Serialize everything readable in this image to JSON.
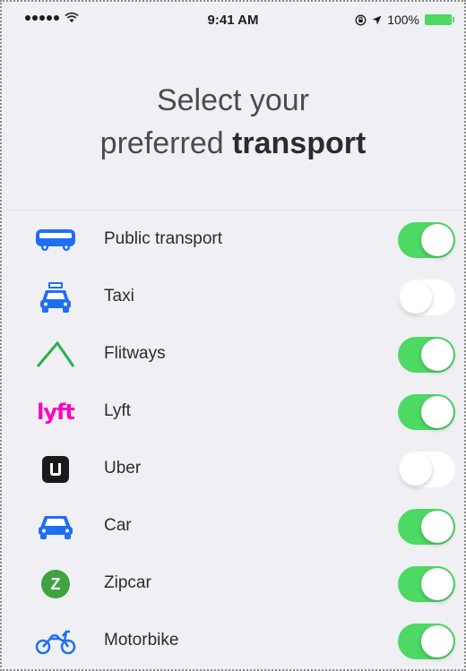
{
  "status_bar": {
    "time": "9:41 AM",
    "battery": "100%"
  },
  "header": {
    "title_line1": "Select your",
    "title_line2_prefix": "preferred ",
    "title_line2_strong": "transport"
  },
  "transport_options": [
    {
      "label": "Public transport",
      "icon": "bus-icon",
      "enabled": true
    },
    {
      "label": "Taxi",
      "icon": "taxi-icon",
      "enabled": false
    },
    {
      "label": "Flitways",
      "icon": "flitways-logo-icon",
      "enabled": true
    },
    {
      "label": "Lyft",
      "icon": "lyft-logo-icon",
      "logo_text": "lyft",
      "enabled": true
    },
    {
      "label": "Uber",
      "icon": "uber-logo-icon",
      "enabled": false
    },
    {
      "label": "Car",
      "icon": "car-icon",
      "enabled": true
    },
    {
      "label": "Zipcar",
      "icon": "zipcar-logo-icon",
      "logo_text": "Z",
      "enabled": true
    },
    {
      "label": "Motorbike",
      "icon": "motorbike-icon",
      "enabled": true
    }
  ],
  "colors": {
    "accent_blue": "#1d6ff2",
    "toggle_on": "#4cd964",
    "lyft_pink": "#ff00bf",
    "flitways_green": "#2ab24b",
    "zipcar_green": "#3ea340"
  }
}
